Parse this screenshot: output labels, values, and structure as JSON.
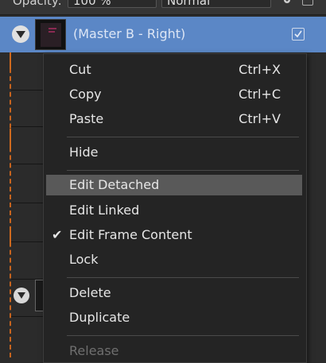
{
  "toolbar": {
    "opacity_label": "Opacity:",
    "opacity_value": "100 %",
    "blend_mode": "Normal"
  },
  "layer": {
    "name": "(Master B - Right)",
    "visible_checked": true
  },
  "context_menu": {
    "items": [
      {
        "label": "Cut",
        "shortcut": "Ctrl+X"
      },
      {
        "label": "Copy",
        "shortcut": "Ctrl+C"
      },
      {
        "label": "Paste",
        "shortcut": "Ctrl+V"
      },
      {
        "label": "Hide"
      },
      {
        "label": "Edit Detached",
        "highlighted": true
      },
      {
        "label": "Edit Linked"
      },
      {
        "label": "Edit Frame Content",
        "checked": true,
        "check_glyph": "✔"
      },
      {
        "label": "Lock"
      },
      {
        "label": "Delete"
      },
      {
        "label": "Duplicate"
      },
      {
        "label": "Release",
        "disabled": true
      }
    ]
  },
  "colors": {
    "selection_blue": "#5b87c6",
    "menu_background": "#242424",
    "menu_highlight": "#595959",
    "timeline_orange": "#d06a1e"
  }
}
